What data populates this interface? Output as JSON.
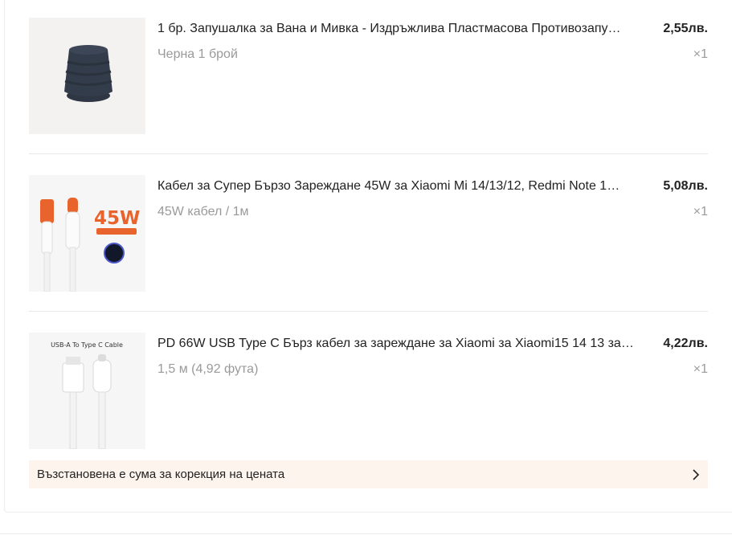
{
  "items": [
    {
      "title": "1 бр. Запушалка за Вана и Мивка - Издръжлива Пластмасова Противозапу…",
      "variant": "Черна 1 брой",
      "price": "2,55лв.",
      "qty": "×1",
      "image_icon": "drain-stopper-image"
    },
    {
      "title": "Кабел за Супер Бързо Зареждане 45W за Xiaomi Mi 14/13/12, Redmi Note 1…",
      "variant": "45W кабел / 1м",
      "price": "5,08лв.",
      "qty": "×1",
      "image_icon": "usb-cable-45w-image",
      "image_text": "45W"
    },
    {
      "title": "PD 66W USB Type C Бърз кабел за зареждане за Xiaomi за Xiaomi15 14 13 за…",
      "variant": "1,5 м (4,92 фута)",
      "price": "4,22лв.",
      "qty": "×1",
      "image_icon": "usb-type-c-cable-image",
      "image_text": "USB-A To Type C Cable"
    }
  ],
  "notice": {
    "text": "Възстановена е сума за корекция на цената",
    "icon": "chevron-right-icon"
  },
  "colors": {
    "notice_bg": "#fdf4ee",
    "muted_text": "#9a9a9a",
    "cable_orange": "#e8642c"
  }
}
